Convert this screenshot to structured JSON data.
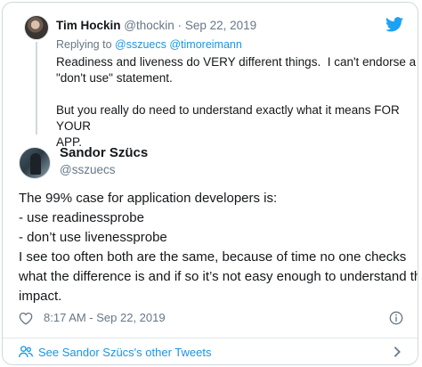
{
  "parent_tweet": {
    "author_name": "Tim Hockin",
    "author_handle": "@thockin",
    "separator": "·",
    "date": "Sep 22, 2019",
    "reply_prefix": "Replying to",
    "reply_to_1": "@sszuecs",
    "reply_to_2": "@timoreimann",
    "paragraph_1_line_1": "Readiness and liveness do VERY different things.  I can't endorse a blanket",
    "paragraph_1_line_2": "\"don't use\" statement.",
    "paragraph_2_line_1": "But you really do need to understand exactly what it means FOR YOUR",
    "paragraph_2_line_2": "APP."
  },
  "main_tweet": {
    "author_name": "Sandor Szücs",
    "author_handle": "@sszuecs",
    "body_lines": [
      "The 99% case for application developers is:",
      "- use readinessprobe",
      "- don’t use livenessprobe",
      "I see too often both are the same, because of time no one checks",
      "what the difference is and if so it’s not easy enough to understand the",
      "impact."
    ],
    "timestamp": "8:17 AM - Sep 22, 2019"
  },
  "footer": {
    "label": "See Sandor Szücs's other Tweets"
  },
  "icons": {
    "brand": "twitter-bird-icon",
    "like": "heart-icon",
    "info": "info-icon",
    "people": "people-icon",
    "more": "chevron-right-icon"
  },
  "colors": {
    "accent": "#1da1f2",
    "link": "#1b95e0",
    "secondary_text": "#657786",
    "border": "#cfd9de"
  }
}
